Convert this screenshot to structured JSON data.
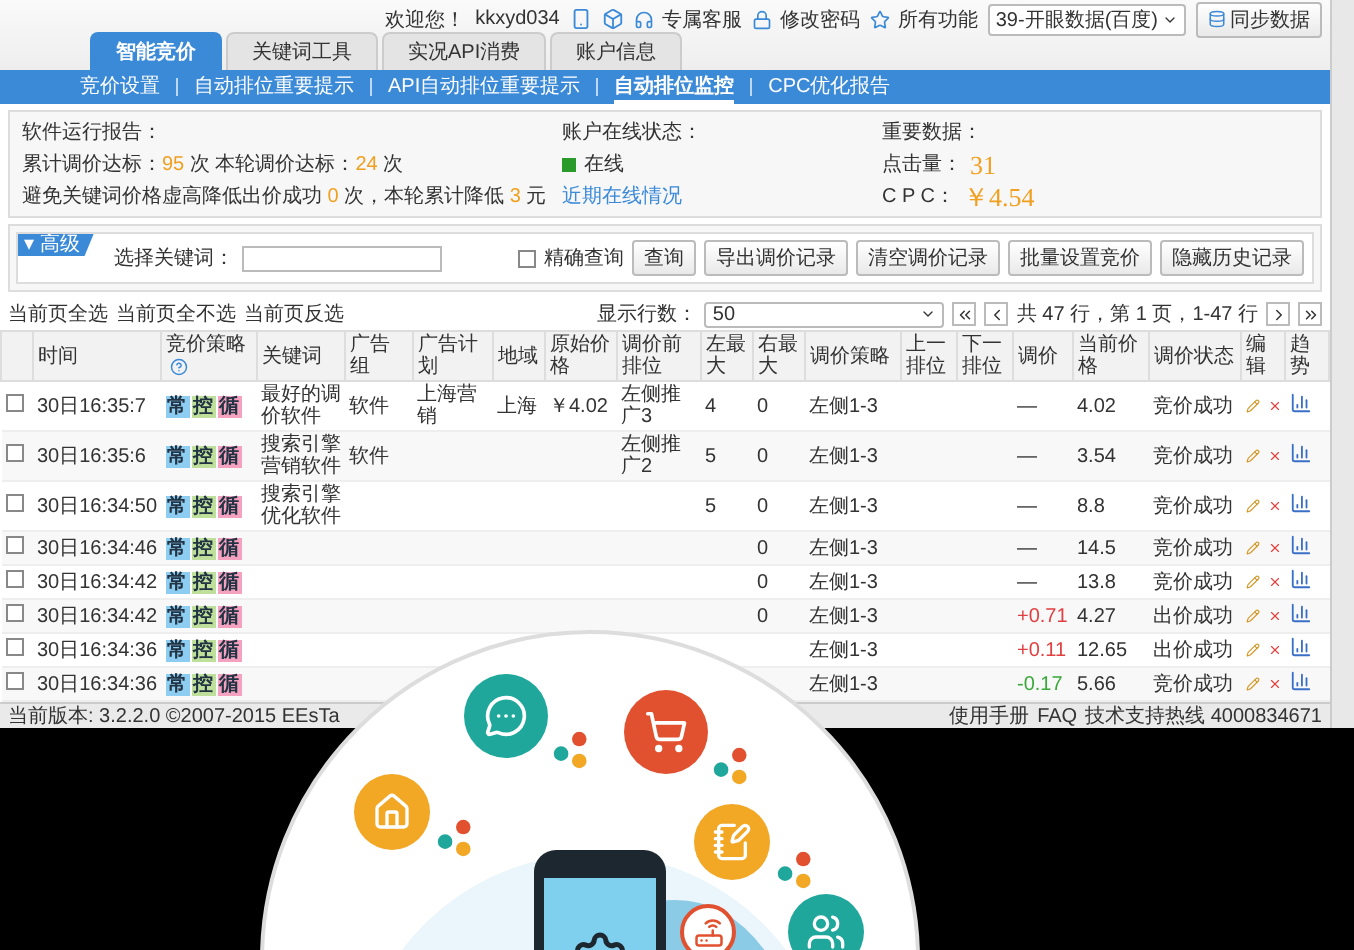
{
  "top_bar": {
    "welcome": "欢迎您！",
    "user": "kkxyd034",
    "links": [
      "专属客服",
      "修改密码",
      "所有功能"
    ],
    "account_select": "39-开眼数据(百度)",
    "sync_button": "同步数据"
  },
  "tabs": [
    {
      "label": "智能竞价",
      "selected": true
    },
    {
      "label": "关键词工具",
      "selected": false
    },
    {
      "label": "实况API消费",
      "selected": false
    },
    {
      "label": "账户信息",
      "selected": false
    }
  ],
  "sub_nav": [
    {
      "label": "竞价设置",
      "selected": false
    },
    {
      "label": "自动排位重要提示",
      "selected": false
    },
    {
      "label": "API自动排位重要提示",
      "selected": false
    },
    {
      "label": "自动排位监控",
      "selected": true
    },
    {
      "label": "CPC优化报告",
      "selected": false
    }
  ],
  "report": {
    "title": "软件运行报告：",
    "lines": [
      [
        {
          "kind": "label",
          "text": "累计调价达标："
        },
        {
          "kind": "value",
          "text": "95"
        },
        {
          "kind": "label",
          "text": " 次  本轮调价达标："
        },
        {
          "kind": "value",
          "text": "24"
        },
        {
          "kind": "label",
          "text": " 次"
        }
      ],
      [
        {
          "kind": "label",
          "text": "避免关键词价格虚高降低出价成功 "
        },
        {
          "kind": "value",
          "text": "0"
        },
        {
          "kind": "label",
          "text": " 次，本轮累计降低 "
        },
        {
          "kind": "value",
          "text": "3"
        },
        {
          "kind": "label",
          "text": " 元"
        }
      ]
    ]
  },
  "online": {
    "title": "账户在线状态：",
    "status": "在线",
    "link": "近期在线情况"
  },
  "key_data": {
    "title": "重要数据：",
    "clicks_label": "点击量：",
    "clicks": "31",
    "cpc_label": "C P C：",
    "cpc": "￥4.54"
  },
  "search": {
    "tag": "▾ 高级",
    "label": "选择关键词：",
    "exact": {
      "label": "精确查询",
      "checked": false
    },
    "buttons": [
      "查询",
      "导出调价记录",
      "清空调价记录",
      "批量设置竞价",
      "隐藏历史记录"
    ]
  },
  "toolbar": {
    "links": [
      "当前页全选",
      "当前页全不选",
      "当前页反选"
    ],
    "rows_label": "显示行数：",
    "rows_value": "50",
    "page_info": "共 47 行，第 1 页，1-47 行"
  },
  "table": {
    "columns": [
      "时间",
      "竞价策略",
      "关键词",
      "广告组",
      "广告计划",
      "地域",
      "原始价格",
      "调价前排位",
      "左最大",
      "右最大",
      "调价策略",
      "上一排位",
      "下一排位",
      "调价",
      "当前价格",
      "调价状态",
      "编辑",
      "趋势"
    ],
    "rows": [
      {
        "checked": false,
        "time": "30日16:35:7",
        "tags": [
          {
            "text": "常",
            "color": "#8ecdf2"
          },
          {
            "text": "控",
            "color": "#bfe09a"
          },
          {
            "text": "循",
            "color": "#f4a2bf"
          }
        ],
        "keyword": "最好的调价软件",
        "ad_group": "软件",
        "plan": "上海营销",
        "region": "上海",
        "orig_price": "￥4.02",
        "prev_rank": "左侧推广3",
        "left_max": "4",
        "right_max": "0",
        "strategy": "左侧1-3",
        "adjust": {
          "text": "—",
          "kind": "none"
        },
        "price": "4.02",
        "status": "竞价成功"
      },
      {
        "checked": false,
        "time": "30日16:35:6",
        "tags": [
          {
            "text": "常",
            "color": "#8ecdf2"
          },
          {
            "text": "控",
            "color": "#bfe09a"
          },
          {
            "text": "循",
            "color": "#f4a2bf"
          }
        ],
        "keyword": "搜索引擎营销软件",
        "ad_group": "软件",
        "prev_rank": "左侧推广2",
        "left_max": "5",
        "right_max": "0",
        "strategy": "左侧1-3",
        "adjust": {
          "text": "—",
          "kind": "none"
        },
        "price": "3.54",
        "status": "竞价成功"
      },
      {
        "checked": false,
        "time": "30日16:34:50",
        "tags": [
          {
            "text": "常",
            "color": "#8ecdf2"
          },
          {
            "text": "控",
            "color": "#bfe09a"
          },
          {
            "text": "循",
            "color": "#f4a2bf"
          }
        ],
        "keyword": "搜索引擎优化软件",
        "left_max": "5",
        "right_max": "0",
        "strategy": "左侧1-3",
        "adjust": {
          "text": "—",
          "kind": "none"
        },
        "price": "8.8",
        "status": "竞价成功"
      },
      {
        "checked": false,
        "time": "30日16:34:46",
        "tags": [
          {
            "text": "常",
            "color": "#8ecdf2"
          },
          {
            "text": "控",
            "color": "#bfe09a"
          },
          {
            "text": "循",
            "color": "#f4a2bf"
          }
        ],
        "right_max": "0",
        "strategy": "左侧1-3",
        "adjust": {
          "text": "—",
          "kind": "none"
        },
        "price": "14.5",
        "status": "竞价成功"
      },
      {
        "checked": false,
        "time": "30日16:34:42",
        "tags": [
          {
            "text": "常",
            "color": "#8ecdf2"
          },
          {
            "text": "控",
            "color": "#bfe09a"
          },
          {
            "text": "循",
            "color": "#f4a2bf"
          }
        ],
        "right_max": "0",
        "strategy": "左侧1-3",
        "adjust": {
          "text": "—",
          "kind": "none"
        },
        "price": "13.8",
        "status": "竞价成功"
      },
      {
        "checked": false,
        "time": "30日16:34:42",
        "tags": [
          {
            "text": "常",
            "color": "#8ecdf2"
          },
          {
            "text": "控",
            "color": "#bfe09a"
          },
          {
            "text": "循",
            "color": "#f4a2bf"
          }
        ],
        "right_max": "0",
        "strategy": "左侧1-3",
        "adjust": {
          "text": "+0.71",
          "kind": "up"
        },
        "price": "4.27",
        "status": "出价成功"
      },
      {
        "checked": false,
        "time": "30日16:34:36",
        "tags": [
          {
            "text": "常",
            "color": "#8ecdf2"
          },
          {
            "text": "控",
            "color": "#bfe09a"
          },
          {
            "text": "循",
            "color": "#f4a2bf"
          }
        ],
        "strategy": "左侧1-3",
        "adjust": {
          "text": "+0.11",
          "kind": "up"
        },
        "price": "12.65",
        "status": "出价成功"
      },
      {
        "checked": false,
        "time": "30日16:34:36",
        "tags": [
          {
            "text": "常",
            "color": "#8ecdf2"
          },
          {
            "text": "控",
            "color": "#bfe09a"
          },
          {
            "text": "循",
            "color": "#f4a2bf"
          }
        ],
        "strategy": "左侧1-3",
        "adjust": {
          "text": "-0.17",
          "kind": "down"
        },
        "price": "5.66",
        "status": "竞价成功"
      }
    ]
  },
  "status_bar": {
    "version": "当前版本: 3.2.2.0 ©2007-2015 EEsTa",
    "links": [
      "使用手册",
      "FAQ"
    ],
    "hotline": "技术支持热线 4000834671"
  }
}
